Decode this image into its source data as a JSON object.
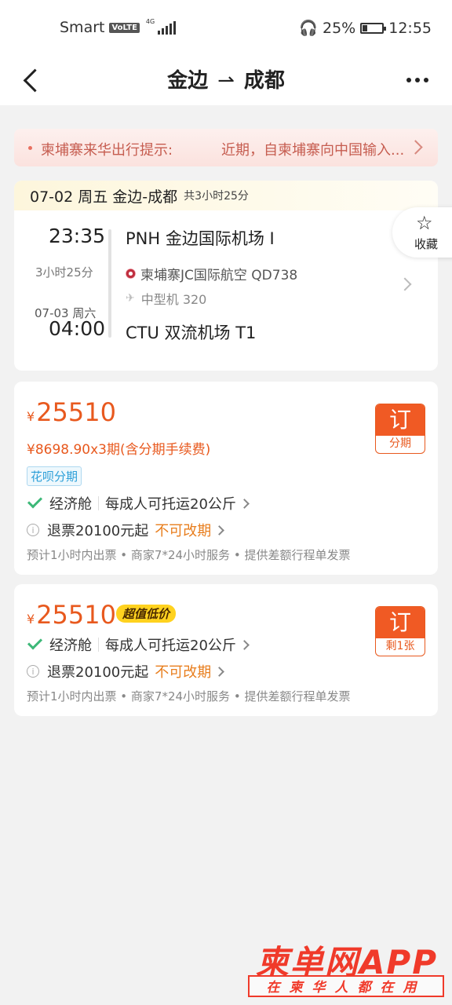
{
  "status_bar": {
    "carrier": "Smart",
    "volte": "VoLTE",
    "network": "4G",
    "battery": "25%",
    "time": "12:55"
  },
  "nav": {
    "from": "金边",
    "arrow": "⇀",
    "to": "成都"
  },
  "notice": {
    "label": "柬埔寨来华出行提示:",
    "text": "近期，自柬埔寨向中国输入..."
  },
  "flight": {
    "header_date": "07-02 周五 金边-成都",
    "header_duration": "共3小时25分",
    "dep_time": "23:35",
    "duration": "3小时25分",
    "arr_date": "07-03 周六",
    "arr_time": "04:00",
    "dep_airport": "PNH 金边国际机场 I",
    "airline": "柬埔寨JC国际航空 QD738",
    "aircraft": "中型机 320",
    "arr_airport": "CTU 双流机场 T1"
  },
  "favorite": {
    "label": "收藏"
  },
  "offers": [
    {
      "currency": "¥",
      "price": "25510",
      "installment": "¥8698.90x3期(含分期手续费)",
      "tag": "花呗分期",
      "cabin": "经济舱",
      "baggage": "每成人可托运20公斤",
      "refund": "退票20100元起",
      "change": "不可改期",
      "footer": "预计1小时内出票 • 商家7*24小时服务 • 提供差额行程单发票",
      "book_label": "订",
      "book_sub": "分期"
    },
    {
      "currency": "¥",
      "price": "25510",
      "badge": "超值低价",
      "cabin": "经济舱",
      "baggage": "每成人可托运20公斤",
      "refund": "退票20100元起",
      "change": "不可改期",
      "footer": "预计1小时内出票 • 商家7*24小时服务 • 提供差额行程单发票",
      "book_label": "订",
      "book_sub": "剩1张"
    }
  ],
  "watermark": {
    "title": "柬单网APP",
    "slogan": "在柬华人都在用"
  },
  "colors": {
    "accent": "#e8591e",
    "notice_text": "#c65d50",
    "check": "#3db878",
    "change_text": "#e87e1e",
    "huabei": "#2c9fd8"
  }
}
